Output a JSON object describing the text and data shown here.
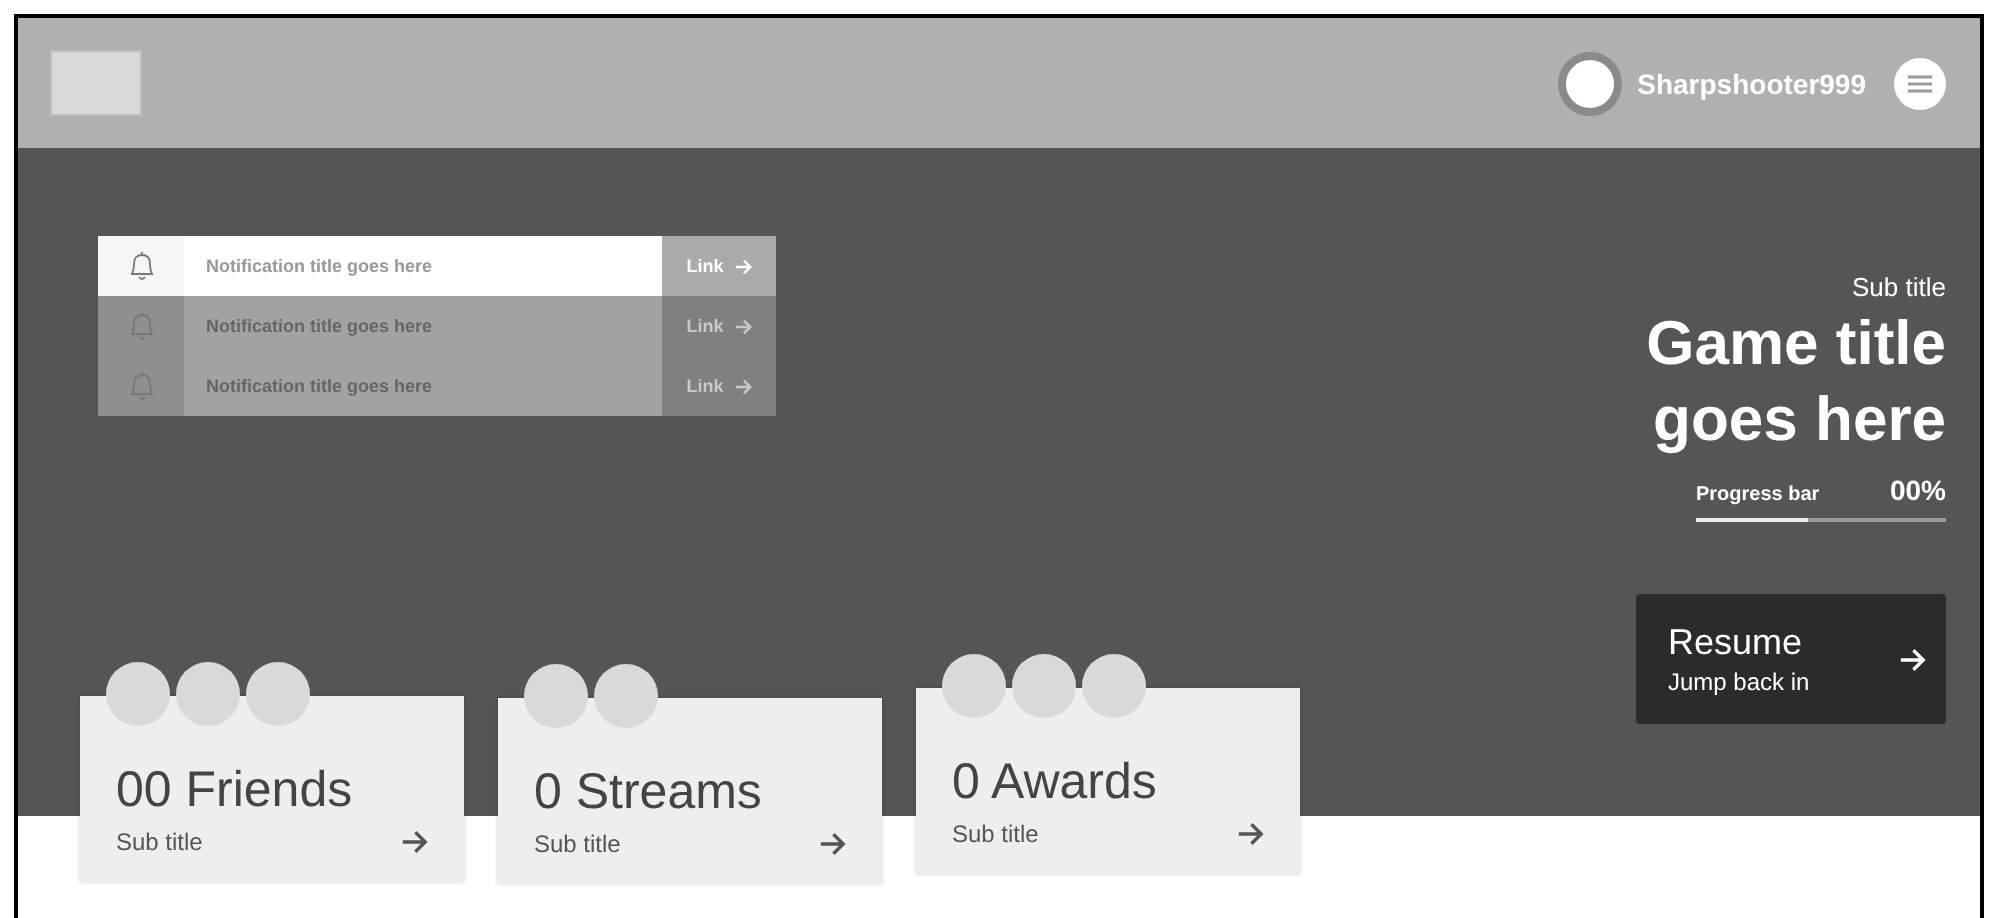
{
  "header": {
    "username": "Sharpshooter999"
  },
  "notifications": [
    {
      "title": "Notification title goes here",
      "link": "Link",
      "selected": true
    },
    {
      "title": "Notification title goes here",
      "link": "Link",
      "selected": false
    },
    {
      "title": "Notification title goes here",
      "link": "Link",
      "selected": false
    }
  ],
  "game": {
    "subtitle": "Sub title",
    "title": "Game title goes here",
    "progress_label": "Progress bar",
    "progress_value": "00%",
    "level": 0.45
  },
  "resume": {
    "label": "Resume",
    "sublabel": "Jump back in"
  },
  "cards": [
    {
      "title": "00 Friends",
      "subtitle": "Sub title",
      "avatars": [
        {
          "kind": "placeholder"
        },
        {
          "kind": "placeholder"
        },
        {
          "kind": "placeholder"
        }
      ]
    },
    {
      "title": "0 Streams",
      "subtitle": "Sub title",
      "avatars": [
        {
          "kind": "placeholder"
        },
        {
          "kind": "placeholder"
        }
      ]
    },
    {
      "title": "0 Awards",
      "subtitle": "Sub title",
      "avatars": [
        {
          "kind": "placeholder"
        },
        {
          "kind": "placeholder"
        },
        {
          "kind": "placeholder"
        }
      ]
    }
  ]
}
